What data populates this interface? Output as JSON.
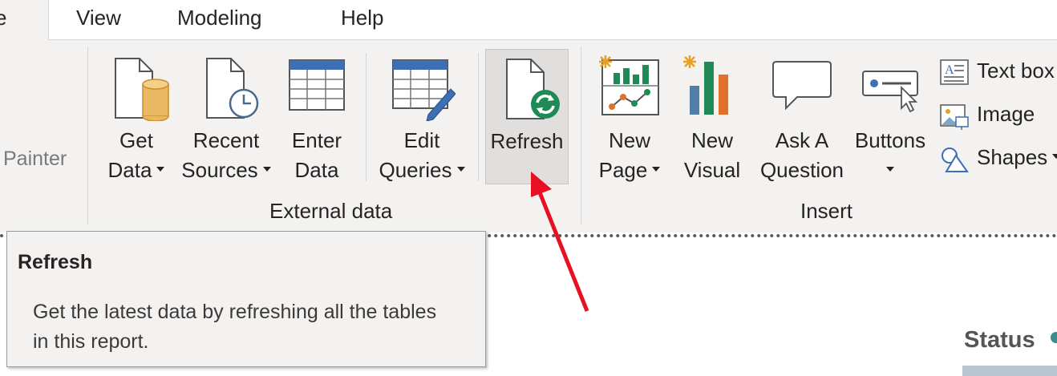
{
  "tabs": [
    {
      "label": "e"
    },
    {
      "label": "View"
    },
    {
      "label": "Modeling"
    },
    {
      "label": "Help"
    }
  ],
  "ribbon": {
    "clipboard": {
      "painter_label": "Painter"
    },
    "external_data": {
      "group_label": "External data",
      "buttons": [
        {
          "line1": "Get",
          "line2": "Data"
        },
        {
          "line1": "Recent",
          "line2": "Sources"
        },
        {
          "line1": "Enter",
          "line2": "Data"
        },
        {
          "line1": "Edit",
          "line2": "Queries"
        },
        {
          "line1": "Refresh"
        }
      ]
    },
    "insert": {
      "group_label": "Insert",
      "buttons": [
        {
          "line1": "New",
          "line2": "Page"
        },
        {
          "line1": "New",
          "line2": "Visual"
        },
        {
          "line1": "Ask A",
          "line2": "Question"
        },
        {
          "line1": "Buttons"
        }
      ],
      "small": [
        {
          "label": "Text box"
        },
        {
          "label": "Image"
        },
        {
          "label": "Shapes"
        }
      ]
    }
  },
  "tooltip": {
    "title": "Refresh",
    "body": "Get the latest data by refreshing all the tables in this report."
  },
  "canvas": {
    "status_label": "Status"
  },
  "colors": {
    "accent_red": "#e81123",
    "ribbon_bg": "#f3f2f1",
    "green_refresh": "#1f8a55"
  }
}
